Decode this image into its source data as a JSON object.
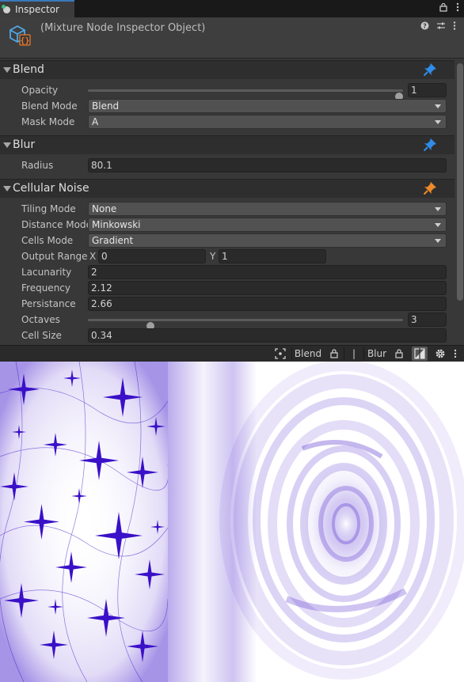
{
  "tabbar": {
    "tab_label": "Inspector",
    "icons": [
      "lock-icon",
      "menu-icon"
    ]
  },
  "header": {
    "title": "(Mixture Node Inspector Object)",
    "icons": [
      "help-icon",
      "settings-sliders-icon",
      "more-icon"
    ],
    "accent": "#3a79bb"
  },
  "sections": {
    "blend": {
      "title": "Blend",
      "pin_color": "#2f8ce8",
      "opacity_label": "Opacity",
      "opacity_value": "1",
      "opacity_fraction": 1.0,
      "blend_mode_label": "Blend Mode",
      "blend_mode_value": "Blend",
      "mask_mode_label": "Mask Mode",
      "mask_mode_value": "A"
    },
    "blur": {
      "title": "Blur",
      "pin_color": "#2f8ce8",
      "radius_label": "Radius",
      "radius_value": "80.1"
    },
    "cellular": {
      "title": "Cellular Noise",
      "pin_color": "#ee8a2a",
      "tiling_label": "Tiling Mode",
      "tiling_value": "None",
      "distance_label": "Distance Mode",
      "distance_value": "Minkowski",
      "cells_label": "Cells Mode",
      "cells_value": "Gradient",
      "range_label": "Output Range",
      "range_x_label": "X",
      "range_x_value": "0",
      "range_y_label": "Y",
      "range_y_value": "1",
      "lacunarity_label": "Lacunarity",
      "lacunarity_value": "2",
      "frequency_label": "Frequency",
      "frequency_value": "2.12",
      "persistance_label": "Persistance",
      "persistance_value": "2.66",
      "octaves_label": "Octaves",
      "octaves_value": "3",
      "octaves_fraction": 0.19,
      "cellsize_label": "Cell Size",
      "cellsize_value": "0.34"
    }
  },
  "toolbar": {
    "blend_label": "Blend",
    "divider": "|",
    "blur_label": "Blur",
    "icons": [
      "frame-icon",
      "lock-icon",
      "lock-icon",
      "compare-icon",
      "gear-icon",
      "more-icon"
    ]
  },
  "preview": {
    "tint": "#3a10c8"
  }
}
